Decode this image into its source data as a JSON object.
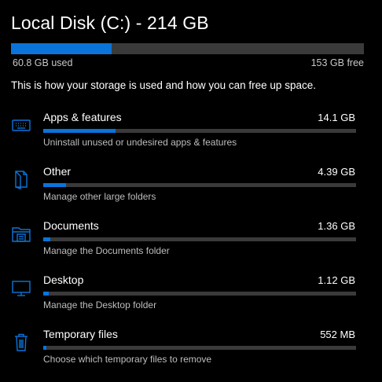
{
  "colors": {
    "background": "#000000",
    "accent": "#0a74da",
    "track": "#3a3a3a",
    "text": "#ffffff",
    "secondary_text": "#bdbdbd"
  },
  "disk": {
    "title": "Local Disk (C:) - 214 GB",
    "used_label": "60.8 GB used",
    "free_label": "153 GB free",
    "used_fraction": 0.284
  },
  "description": "This is how your storage is used and how you can free up space.",
  "categories": [
    {
      "name": "Apps & features",
      "size": "14.1 GB",
      "subtitle": "Uninstall unused or undesired apps & features",
      "icon": "apps-features-icon",
      "fraction": 0.232
    },
    {
      "name": "Other",
      "size": "4.39 GB",
      "subtitle": "Manage other large folders",
      "icon": "other-folders-icon",
      "fraction": 0.072
    },
    {
      "name": "Documents",
      "size": "1.36 GB",
      "subtitle": "Manage the Documents folder",
      "icon": "documents-folder-icon",
      "fraction": 0.022
    },
    {
      "name": "Desktop",
      "size": "1.12 GB",
      "subtitle": "Manage the Desktop folder",
      "icon": "desktop-monitor-icon",
      "fraction": 0.018
    },
    {
      "name": "Temporary files",
      "size": "552 MB",
      "subtitle": "Choose which temporary files to remove",
      "icon": "trash-can-icon",
      "fraction": 0.009
    }
  ]
}
